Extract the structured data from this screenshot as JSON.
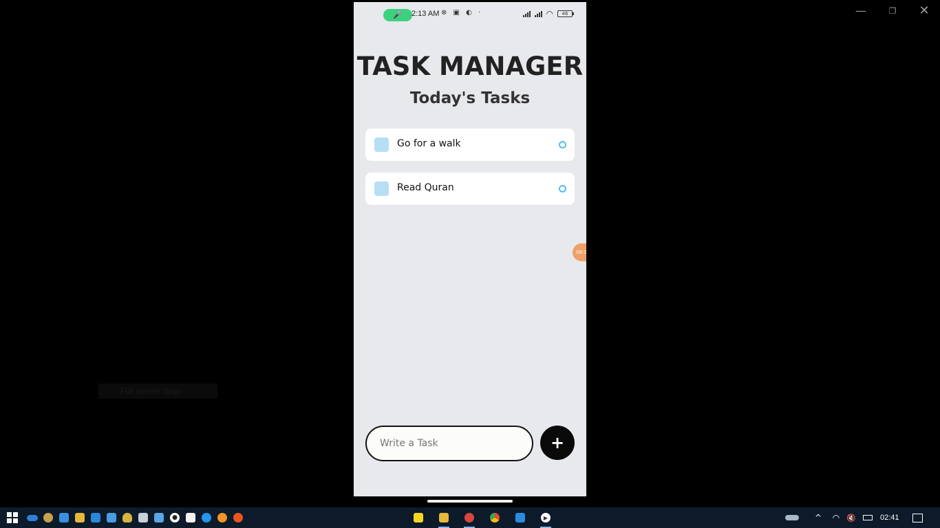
{
  "window_controls": {
    "minimize": "—",
    "maximize": "❐",
    "close": "✕"
  },
  "ghost_label": "Full screen Snip",
  "phone": {
    "status_bar": {
      "mic_icon": "microphone-icon",
      "time": "2:13 AM",
      "left_icons": "⊗ ▣ ◐ ·",
      "battery": "46"
    },
    "title": "TASK MANAGER",
    "subtitle": "Today's Tasks",
    "tasks": [
      {
        "label": "Go for a walk"
      },
      {
        "label": "Read Quran"
      }
    ],
    "float_badge": "00:1",
    "input": {
      "placeholder": "Write a Task",
      "value": ""
    },
    "add_button": "+"
  },
  "taskbar": {
    "start_icon": "windows-start-icon",
    "pinned_left": [
      "onedrive-icon",
      "user-icon",
      "monitor-icon",
      "file-explorer-icon",
      "network-icon",
      "control-panel-icon",
      "recycle-bin-icon",
      "window-icon",
      "app-icon",
      "document-icon",
      "docker-icon",
      "firefox-icon",
      "ubuntu-icon"
    ],
    "pinned_center": [
      "sticky-notes-icon",
      "file-explorer-icon",
      "anydesk-icon",
      "chrome-icon",
      "vscode-icon",
      "media-player-icon"
    ],
    "clock": "02:41"
  },
  "colors": {
    "phone_bg": "#e8e9ed",
    "checkbox": "#b6dff6",
    "radio": "#55bcec",
    "mic_pill": "#3cd27d",
    "badge": "#f0a167"
  }
}
